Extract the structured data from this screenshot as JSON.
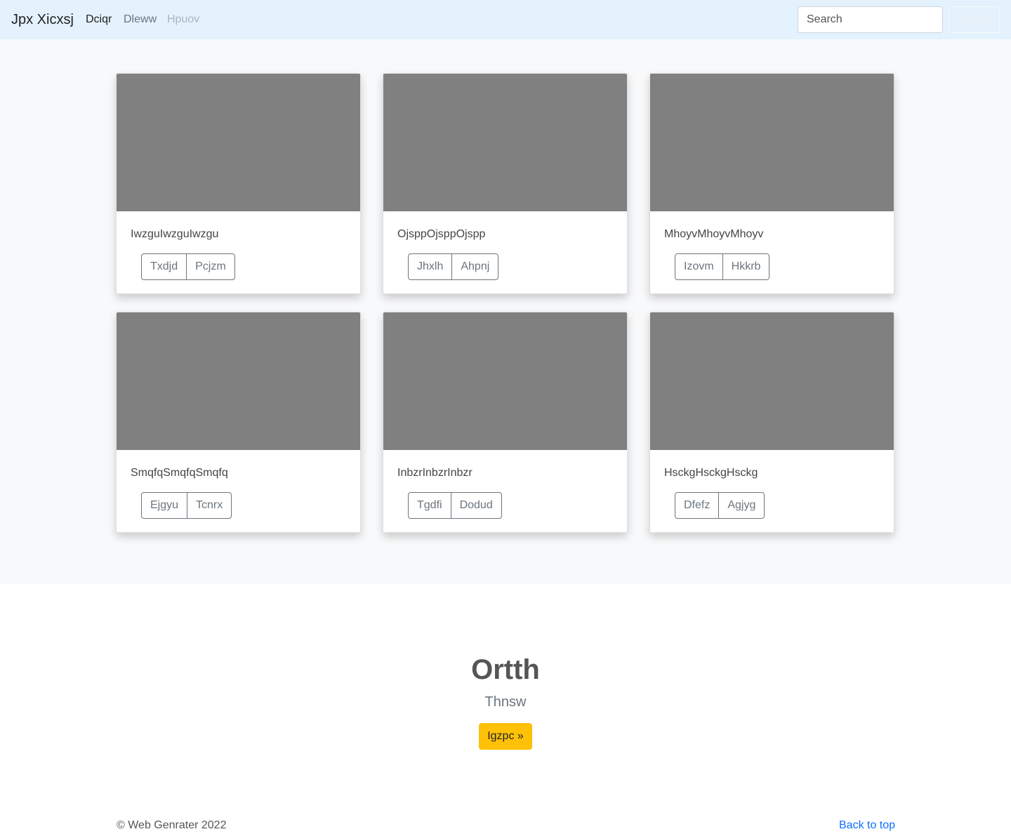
{
  "navbar": {
    "brand": "Jpx Xicxsj",
    "links": [
      "Dciqr",
      "Dleww",
      "Hpuov"
    ],
    "search_placeholder": "Search",
    "search_button": "Search"
  },
  "cards": [
    {
      "text": "IwzguIwzguIwzgu",
      "buttons": [
        "Txdjd",
        "Pcjzm"
      ]
    },
    {
      "text": "OjsppOjsppOjspp",
      "buttons": [
        "Jhxlh",
        "Ahpnj"
      ]
    },
    {
      "text": "MhoyvMhoyvMhoyv",
      "buttons": [
        "Izovm",
        "Hkkrb"
      ]
    },
    {
      "text": "SmqfqSmqfqSmqfq",
      "buttons": [
        "Ejgyu",
        "Tcnrx"
      ]
    },
    {
      "text": "InbzrInbzrInbzr",
      "buttons": [
        "Tgdfi",
        "Dodud"
      ]
    },
    {
      "text": "HsckgHsckgHsckg",
      "buttons": [
        "Dfefz",
        "Agjyg"
      ]
    }
  ],
  "hero": {
    "title": "Ortth",
    "subtitle": "Thnsw",
    "button": "Igzpc »"
  },
  "footer": {
    "copyright": "© Web Genrater 2022",
    "back_to_top": "Back to top"
  },
  "colors": {
    "navbar_bg": "#e3f2fd",
    "album_bg": "#f8f9fa",
    "thumbnail": "#808080",
    "hero_button": "#ffc107",
    "link": "#0d6efd"
  }
}
